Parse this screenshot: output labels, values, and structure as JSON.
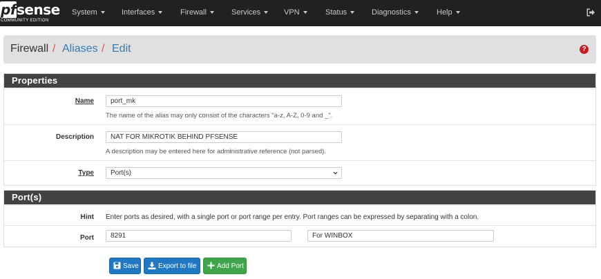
{
  "logo": {
    "brand_prefix": "pf",
    "brand_suffix": "sense",
    "edition": "COMMUNITY EDITION"
  },
  "nav": {
    "items": [
      {
        "label": "System"
      },
      {
        "label": "Interfaces"
      },
      {
        "label": "Firewall"
      },
      {
        "label": "Services"
      },
      {
        "label": "VPN"
      },
      {
        "label": "Status"
      },
      {
        "label": "Diagnostics"
      },
      {
        "label": "Help"
      }
    ],
    "logout_icon": "sign-out-icon"
  },
  "breadcrumb": {
    "items": [
      "Firewall",
      "Aliases",
      "Edit"
    ],
    "separator": "/",
    "help_icon": "question-circle-icon",
    "help_symbol": "?"
  },
  "properties": {
    "heading": "Properties",
    "name": {
      "label": "Name",
      "value": "port_mk",
      "help": "The name of the alias may only consist of the characters \"a-z, A-Z, 0-9 and _\"."
    },
    "description": {
      "label": "Description",
      "value": "NAT FOR MIKROTIK BEHIND PFSENSE",
      "help": "A description may be entered here for administrative reference (not parsed)."
    },
    "type": {
      "label": "Type",
      "selected": "Port(s)"
    }
  },
  "ports": {
    "heading": "Port(s)",
    "hint": {
      "label": "Hint",
      "text": "Enter ports as desired, with a single port or port range per entry. Port ranges can be expressed by separating with a colon."
    },
    "port": {
      "label": "Port",
      "value": "8291",
      "description": "For WINBOX"
    }
  },
  "buttons": {
    "save": "Save",
    "export": "Export to file",
    "add_port": "Add Port"
  },
  "colors": {
    "navbar": "#212121",
    "panel_heading": "#424242",
    "link": "#337ab7",
    "slash": "#d9534f",
    "primary": "#1f78c1",
    "success": "#3fa44a",
    "help": "#c71c22"
  }
}
